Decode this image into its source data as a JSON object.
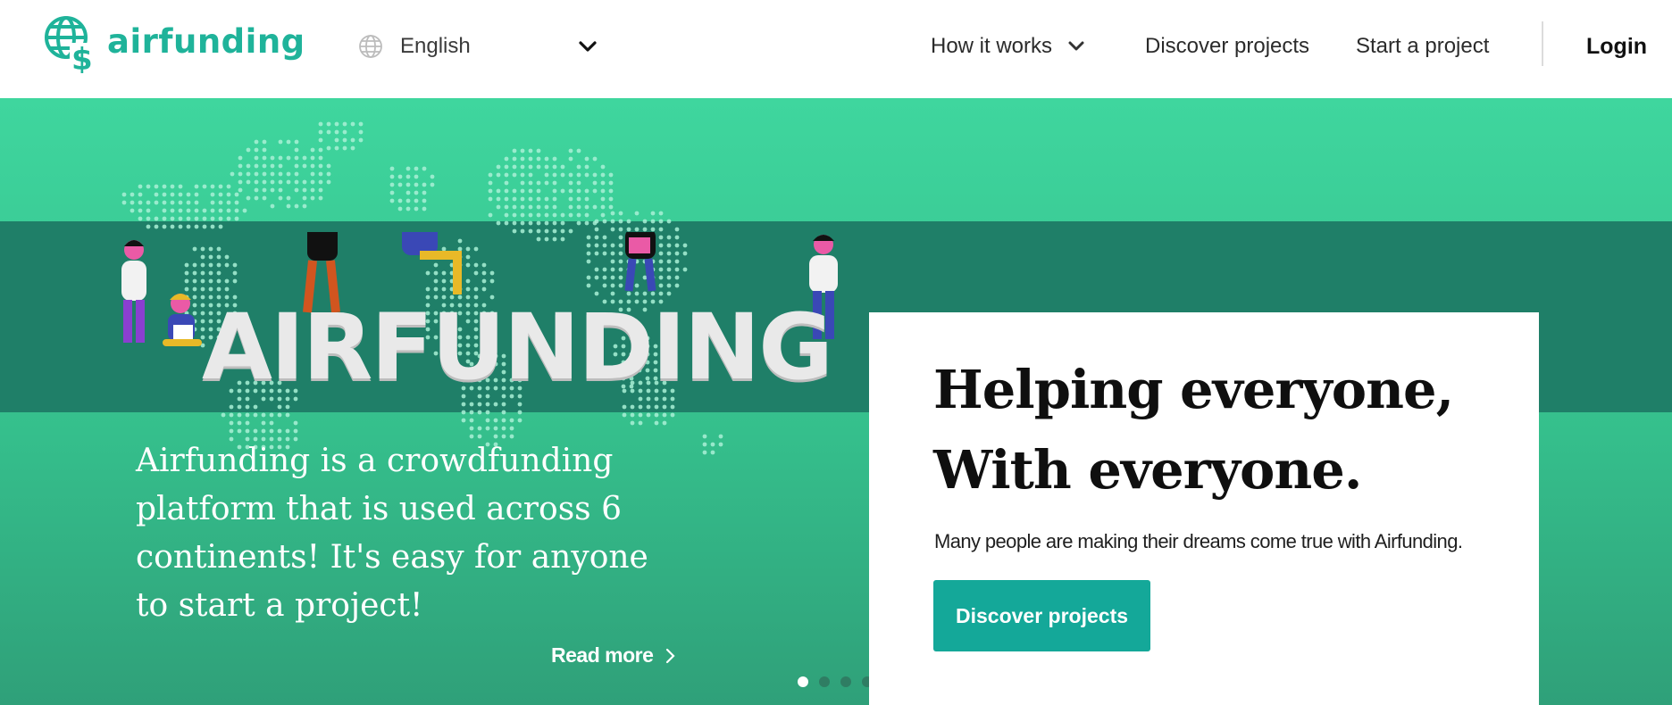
{
  "header": {
    "brand": "airfunding",
    "language": {
      "selected": "English"
    },
    "nav": {
      "how_it_works": "How it works",
      "discover_projects": "Discover projects",
      "start_project": "Start a project",
      "login": "Login"
    }
  },
  "hero": {
    "wordmark": "AIRFUNDING",
    "description": "Airfunding is a crowdfunding platform that is used across 6 continents! It's easy for anyone to start a project!",
    "read_more": "Read more",
    "slides": {
      "count": 4,
      "active": 1
    },
    "card": {
      "title_line1": "Helping everyone,",
      "title_line2": "With everyone.",
      "subtitle": "Many people are making their dreams come true with Airfunding.",
      "button": "Discover projects"
    }
  },
  "colors": {
    "brand": "#1fb39a",
    "hero_top": "#3fd69e",
    "hero_band": "#1f7f68",
    "button": "#14a899"
  },
  "icons": [
    "globe-dollar-logo-icon",
    "globe-icon",
    "chevron-down-icon",
    "chevron-right-icon"
  ]
}
